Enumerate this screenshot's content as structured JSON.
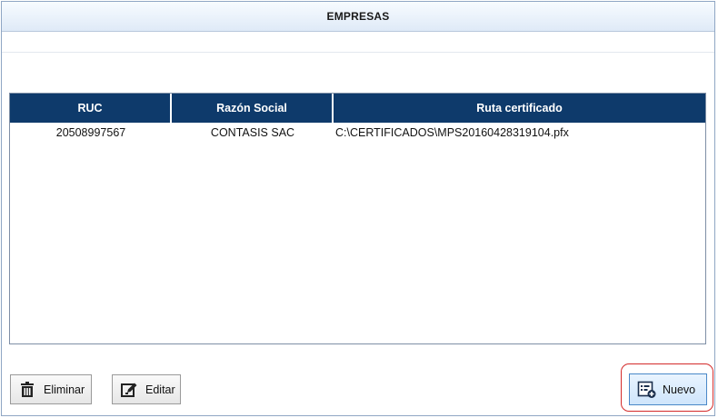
{
  "header": {
    "title": "EMPRESAS"
  },
  "grid": {
    "columns": [
      "RUC",
      "Razón Social",
      "Ruta certificado"
    ],
    "rows": [
      {
        "ruc": "20508997567",
        "razon_social": "CONTASIS SAC",
        "ruta": "C:\\CERTIFICADOS\\MPS20160428319104.pfx"
      }
    ]
  },
  "buttons": {
    "eliminar": "Eliminar",
    "editar": "Editar",
    "nuevo": "Nuevo"
  },
  "icons": {
    "eliminar": "trash-icon",
    "editar": "edit-icon",
    "nuevo": "new-record-icon"
  },
  "colors": {
    "header_bg": "#0e3a6b",
    "highlight": "#d42b2b",
    "nuevo_bg": "#cfe5fb"
  }
}
